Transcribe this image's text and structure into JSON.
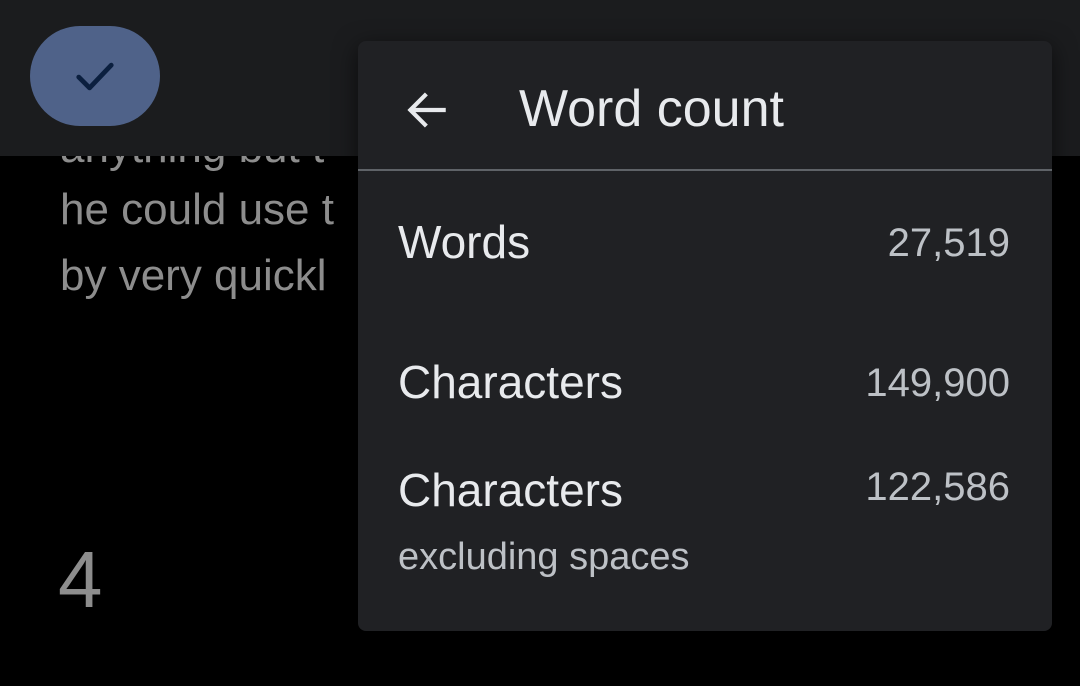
{
  "toolbar": {
    "done_icon": "check-icon",
    "done_color": "#4f6289"
  },
  "document": {
    "lines": [
      "anything but t",
      "he could use t",
      "by very quickl"
    ],
    "page_number": "4"
  },
  "dialog": {
    "back_icon": "arrow-back-icon",
    "title": "Word count",
    "stats": {
      "words": {
        "label": "Words",
        "value": "27,519"
      },
      "characters": {
        "label": "Characters",
        "value": "149,900"
      },
      "characters_no_spaces": {
        "label": "Characters",
        "sublabel": "excluding spaces",
        "value": "122,586"
      }
    }
  },
  "colors": {
    "dialog_bg": "#202124",
    "toolbar_bg": "#1b1c1e",
    "text_primary": "#e8eaed",
    "text_secondary": "#bdc1c6"
  }
}
